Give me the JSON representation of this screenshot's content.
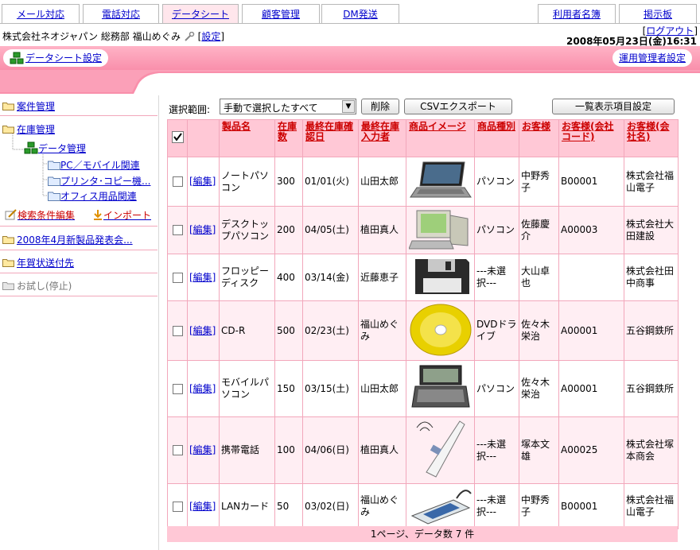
{
  "tabs": [
    {
      "label": "メール対応",
      "active": false
    },
    {
      "label": "電話対応",
      "active": false
    },
    {
      "label": "データシート",
      "active": true
    },
    {
      "label": "顧客管理",
      "active": false
    },
    {
      "label": "DM発送",
      "active": false
    },
    {
      "label": "利用者名簿",
      "active": false
    },
    {
      "label": "掲示板",
      "active": false
    }
  ],
  "header": {
    "user": "株式会社ネオジャパン 総務部 福山めぐみ",
    "settings_open": "[",
    "settings": "設定",
    "settings_close": "]",
    "logout_open": "[",
    "logout": "ログアウト",
    "logout_close": "]",
    "datetime": "2008年05月23日(金)16:31"
  },
  "band": {
    "datasheet_settings": "データシート設定",
    "admin_settings": "運用管理者設定"
  },
  "sidebar": {
    "items": [
      {
        "label": "案件管理"
      },
      {
        "label": "在庫管理"
      },
      {
        "label": "データ管理"
      },
      {
        "label": "PC／モバイル関連"
      },
      {
        "label": "プリンタ･コピー機..."
      },
      {
        "label": "オフィス用品関連"
      },
      {
        "label": "検索条件編集"
      },
      {
        "label": "インポート"
      },
      {
        "label": "2008年4月新製品発表会..."
      },
      {
        "label": "年賀状送付先"
      },
      {
        "label": "お試し(停止)"
      }
    ]
  },
  "toolbar": {
    "range_label": "選択範囲:",
    "range_value": "手動で選択したすべて",
    "delete": "削除",
    "csv": "CSVエクスポート",
    "list_settings": "一覧表示項目設定"
  },
  "table": {
    "headers": [
      "製品名",
      "在庫数",
      "最終在庫確認日",
      "最終在庫入力者",
      "商品イメージ",
      "商品種別",
      "お客様",
      "お客様(会社コード)",
      "お客様(会社名)"
    ],
    "edit_label": "[編集]",
    "rows": [
      {
        "name": "ノートパソコン",
        "stock": "300",
        "date": "01/01(火)",
        "person": "山田太郎",
        "image": "laptop",
        "category": "パソコン",
        "customer": "中野秀子",
        "code": "B00001",
        "company": "株式会社福山電子"
      },
      {
        "name": "デスクトップパソコン",
        "stock": "200",
        "date": "04/05(土)",
        "person": "植田真人",
        "image": "desktop",
        "category": "パソコン",
        "customer": "佐藤慶介",
        "code": "A00003",
        "company": "株式会社大田建設"
      },
      {
        "name": "フロッピーディスク",
        "stock": "400",
        "date": "03/14(金)",
        "person": "近藤恵子",
        "image": "floppy",
        "category": "---未選択---",
        "customer": "大山卓也",
        "code": "",
        "company": "株式会社田中商事"
      },
      {
        "name": "CD-R",
        "stock": "500",
        "date": "02/23(土)",
        "person": "福山めぐみ",
        "image": "cd",
        "category": "DVDドライブ",
        "customer": "佐々木栄治",
        "code": "A00001",
        "company": "五谷鋼鉄所"
      },
      {
        "name": "モバイルパソコン",
        "stock": "150",
        "date": "03/15(土)",
        "person": "山田太郎",
        "image": "mobile",
        "category": "パソコン",
        "customer": "佐々木栄治",
        "code": "A00001",
        "company": "五谷鋼鉄所"
      },
      {
        "name": "携帯電話",
        "stock": "100",
        "date": "04/06(日)",
        "person": "植田真人",
        "image": "phone",
        "category": "---未選択---",
        "customer": "塚本文雄",
        "code": "A00025",
        "company": "株式会社塚本商会"
      },
      {
        "name": "LANカード",
        "stock": "50",
        "date": "03/02(日)",
        "person": "福山めぐみ",
        "image": "lancard",
        "category": "---未選択---",
        "customer": "中野秀子",
        "code": "B00001",
        "company": "株式会社福山電子"
      }
    ]
  },
  "footer": "1ページ、データ数 7 件",
  "colors": {
    "accent_pink": "#f98fab",
    "header_pink": "#ffc8d6",
    "link": "#0000cc",
    "header_text": "#cc0000"
  }
}
